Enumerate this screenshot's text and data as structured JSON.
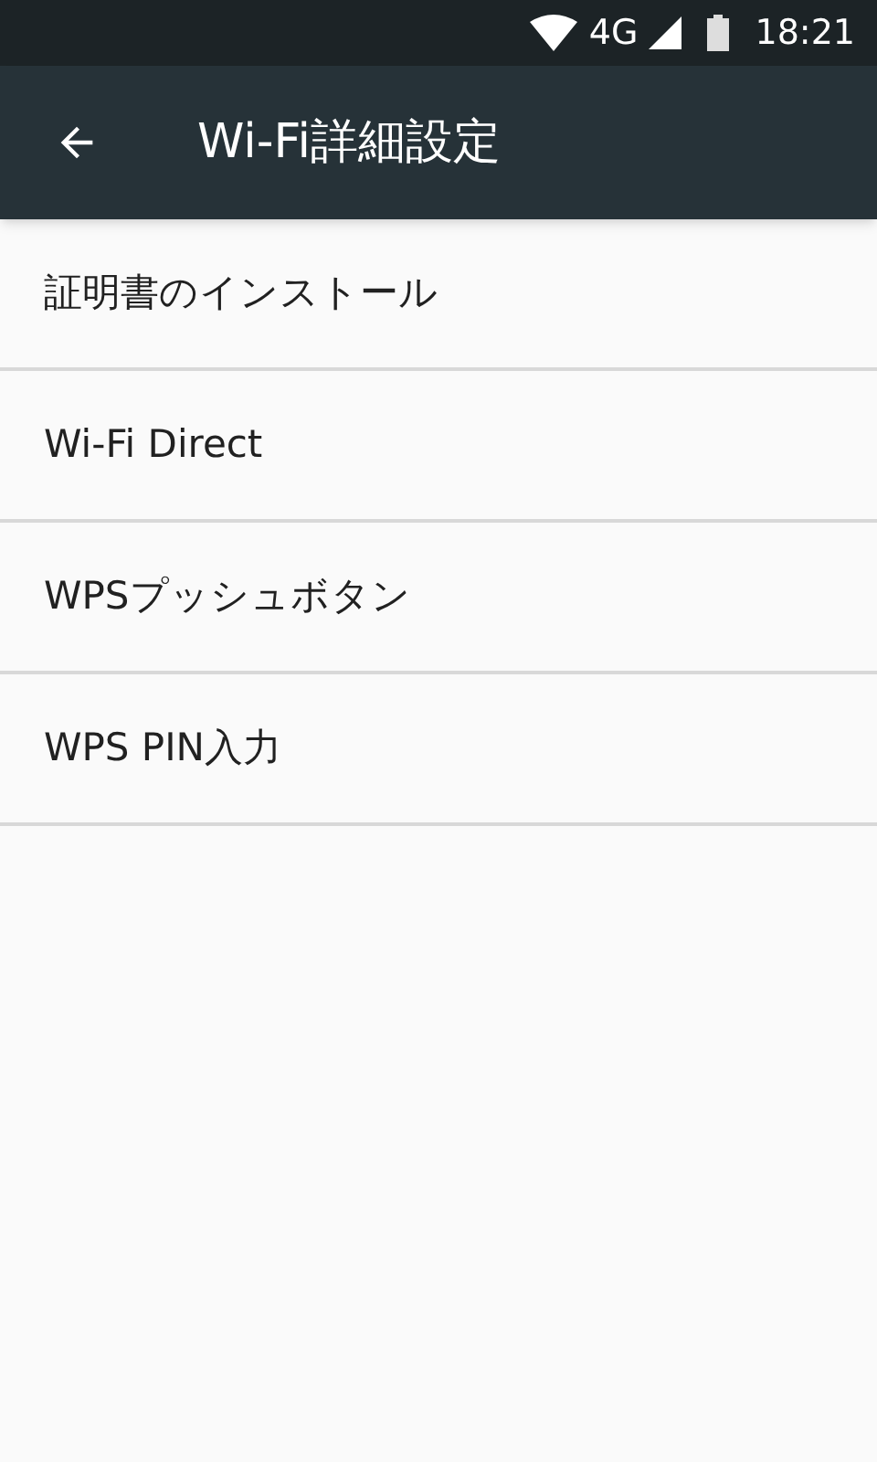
{
  "status_bar": {
    "network": "4G",
    "time": "18:21"
  },
  "toolbar": {
    "title": "Wi-Fi詳細設定"
  },
  "items": [
    {
      "label": "証明書のインストール"
    },
    {
      "label": "Wi-Fi Direct"
    },
    {
      "label": "WPSプッシュボタン"
    },
    {
      "label": "WPS PIN入力"
    }
  ]
}
